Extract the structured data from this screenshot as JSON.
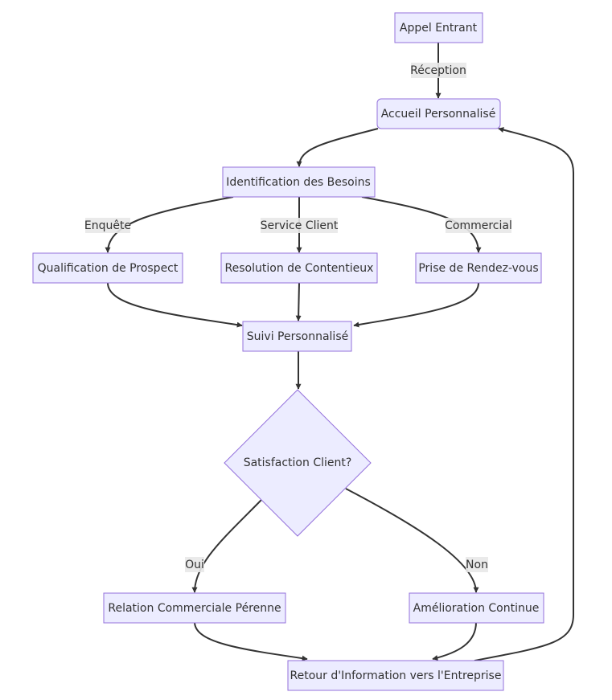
{
  "diagram": {
    "type": "flowchart",
    "direction": "top-down",
    "colors": {
      "node_fill": "#ECECFF",
      "node_stroke": "#9370DB",
      "edge": "#333333",
      "edge_label_bg": "#E8E8E8",
      "text": "#333333"
    },
    "nodes": {
      "appel": "Appel Entrant",
      "accueil": "Accueil Personnalisé",
      "identification": "Identification des Besoins",
      "qualification": "Qualification de Prospect",
      "resolution": "Resolution de Contentieux",
      "rdv": "Prise de Rendez-vous",
      "suivi": "Suivi Personnalisé",
      "satisfaction": "Satisfaction Client?",
      "relation": "Relation Commerciale Pérenne",
      "amelioration": "Amélioration Continue",
      "retour": "Retour d'Information vers l'Entreprise"
    },
    "edge_labels": {
      "reception": "Réception",
      "enquete": "Enquête",
      "service_client": "Service Client",
      "commercial": "Commercial",
      "oui": "Oui",
      "non": "Non"
    },
    "edges": [
      {
        "from": "appel",
        "to": "accueil",
        "label": "Réception"
      },
      {
        "from": "accueil",
        "to": "identification"
      },
      {
        "from": "identification",
        "to": "qualification",
        "label": "Enquête"
      },
      {
        "from": "identification",
        "to": "resolution",
        "label": "Service Client"
      },
      {
        "from": "identification",
        "to": "rdv",
        "label": "Commercial"
      },
      {
        "from": "qualification",
        "to": "suivi"
      },
      {
        "from": "resolution",
        "to": "suivi"
      },
      {
        "from": "rdv",
        "to": "suivi"
      },
      {
        "from": "suivi",
        "to": "satisfaction"
      },
      {
        "from": "satisfaction",
        "to": "relation",
        "label": "Oui"
      },
      {
        "from": "satisfaction",
        "to": "amelioration",
        "label": "Non"
      },
      {
        "from": "relation",
        "to": "retour"
      },
      {
        "from": "amelioration",
        "to": "retour"
      },
      {
        "from": "retour",
        "to": "accueil"
      }
    ]
  }
}
